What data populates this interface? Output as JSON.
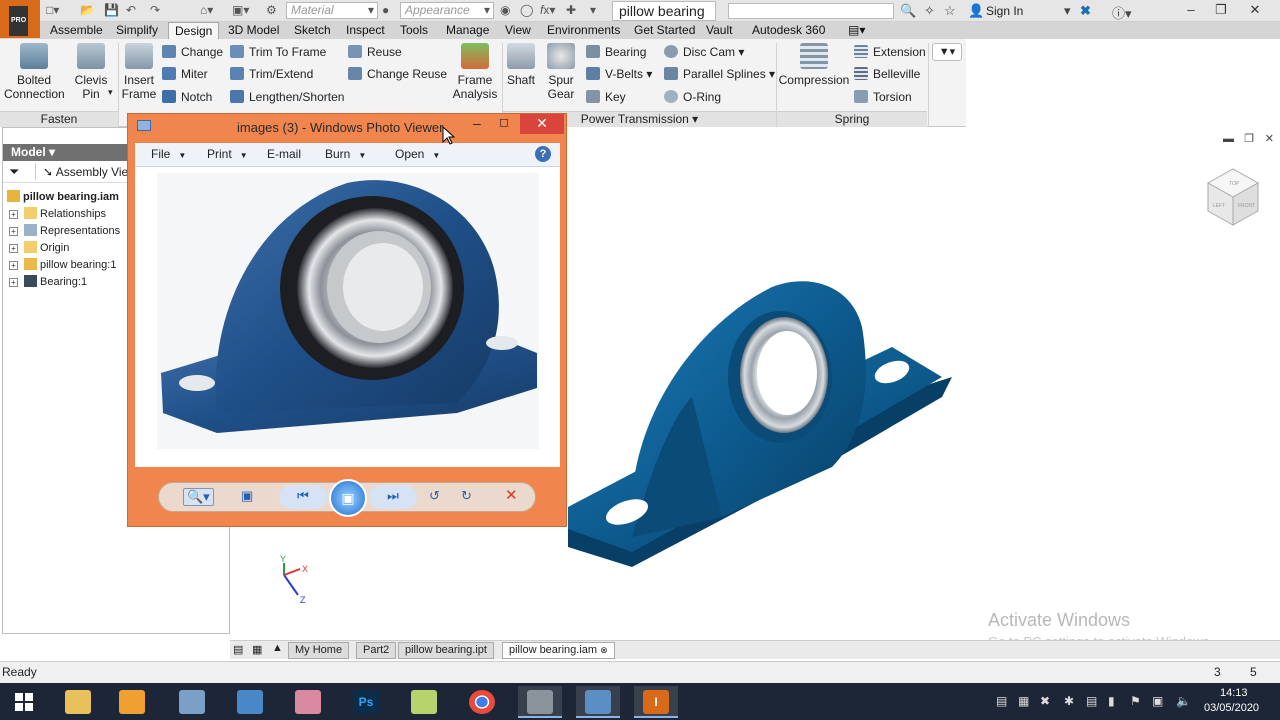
{
  "titlebar": {
    "logo_text": "I",
    "logo_badge": "PRO",
    "material_placeholder": "Material",
    "appearance_placeholder": "Appearance",
    "document_title": "pillow bearing",
    "sign_in": "Sign In"
  },
  "tabs": [
    "Assemble",
    "Simplify",
    "Design",
    "3D Model",
    "Sketch",
    "Inspect",
    "Tools",
    "Manage",
    "View",
    "Environments",
    "Get Started",
    "Vault",
    "Autodesk 360"
  ],
  "active_tab": "Design",
  "ribbon": {
    "fasten": {
      "title": "Fasten",
      "bolted": "Bolted\nConnection",
      "clevis": "Clevis\nPin"
    },
    "frame": {
      "insert_frame": "Insert\nFrame",
      "change": "Change",
      "miter": "Miter",
      "notch": "Notch",
      "trim_to_frame": "Trim To Frame",
      "trim_extend": "Trim/Extend",
      "lengthen_shorten": "Lengthen/Shorten",
      "reuse": "Reuse",
      "change_reuse": "Change Reuse",
      "frame_analysis": "Frame\nAnalysis"
    },
    "power_transmission": {
      "title": "Power Transmission",
      "shaft": "Shaft",
      "spur_gear": "Spur\nGear",
      "bearing": "Bearing",
      "v_belts": "V-Belts",
      "key": "Key",
      "disc_cam": "Disc Cam",
      "parallel_splines": "Parallel Splines",
      "o_ring": "O-Ring"
    },
    "spring": {
      "title": "Spring",
      "compression": "Compression",
      "extension": "Extension",
      "belleville": "Belleville",
      "torsion": "Torsion"
    }
  },
  "browser": {
    "header": "Model",
    "view_label": "Assembly View",
    "root": "pillow bearing.iam",
    "items": [
      "Relationships",
      "Representations",
      "Origin",
      "pillow bearing:1",
      "Bearing:1"
    ]
  },
  "photo_viewer": {
    "title": "images (3) - Windows Photo Viewer",
    "menus": [
      "File",
      "Print",
      "E-mail",
      "Burn",
      "Open"
    ]
  },
  "doc_tabs": [
    "My Home",
    "Part2",
    "pillow bearing.ipt",
    "pillow bearing.iam"
  ],
  "active_doc_tab": "pillow bearing.iam",
  "status": {
    "text": "Ready",
    "count_a": "3",
    "count_b": "5"
  },
  "watermark": {
    "title": "Activate Windows",
    "subtitle": "Go to PC settings to activate Windows."
  },
  "taskbar": {
    "time": "14:13",
    "date": "03/05/2020"
  },
  "viewcube": {
    "top": "TOP",
    "left": "LEFT",
    "front": "FRONT"
  },
  "triad": {
    "x": "X",
    "y": "Y",
    "z": "Z"
  },
  "colors": {
    "bearing_blue": "#0d5b8f",
    "photo_viewer_frame": "#f0854d",
    "accent_orange": "#d86a1a",
    "taskbar": "#1d2636"
  }
}
